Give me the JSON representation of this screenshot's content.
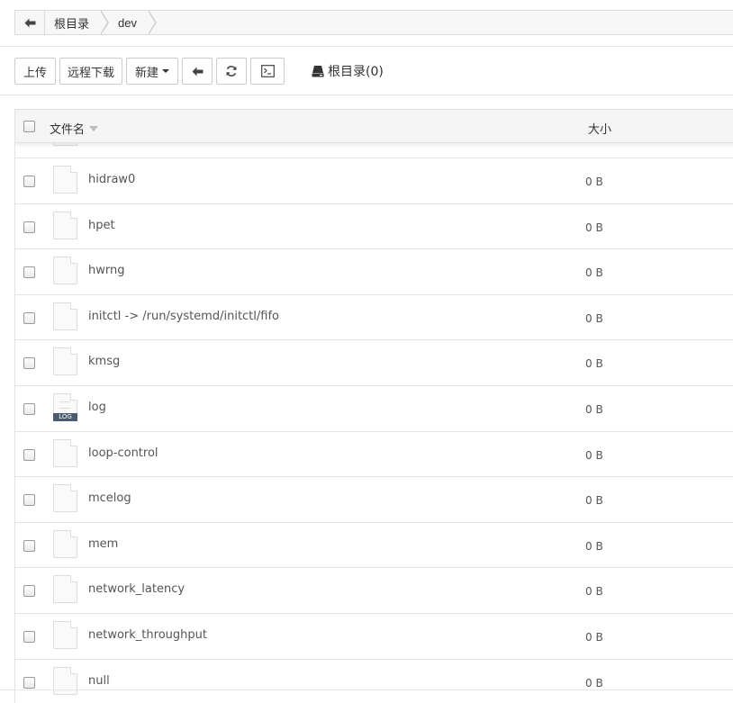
{
  "breadcrumb": {
    "items": [
      {
        "label": "根目录"
      },
      {
        "label": "dev"
      }
    ]
  },
  "toolbar": {
    "upload_label": "上传",
    "remote_download_label": "远程下载",
    "new_label": "新建",
    "root_info_label": "根目录(0)"
  },
  "table": {
    "header": {
      "name_label": "文件名",
      "size_label": "大小"
    },
    "rows": [
      {
        "name": "hidraw0",
        "size": "0 B",
        "icon": "file-icon"
      },
      {
        "name": "hpet",
        "size": "0 B",
        "icon": "file-icon"
      },
      {
        "name": "hwrng",
        "size": "0 B",
        "icon": "file-icon"
      },
      {
        "name": "initctl -> /run/systemd/initctl/fifo",
        "size": "0 B",
        "icon": "file-icon"
      },
      {
        "name": "kmsg",
        "size": "0 B",
        "icon": "file-icon"
      },
      {
        "name": "log",
        "size": "0 B",
        "icon": "log-file-icon",
        "icon_tag": "LOG"
      },
      {
        "name": "loop-control",
        "size": "0 B",
        "icon": "file-icon"
      },
      {
        "name": "mcelog",
        "size": "0 B",
        "icon": "file-icon"
      },
      {
        "name": "mem",
        "size": "0 B",
        "icon": "file-icon"
      },
      {
        "name": "network_latency",
        "size": "0 B",
        "icon": "file-icon"
      },
      {
        "name": "network_throughput",
        "size": "0 B",
        "icon": "file-icon"
      },
      {
        "name": "null",
        "size": "0 B",
        "icon": "file-icon"
      }
    ]
  }
}
